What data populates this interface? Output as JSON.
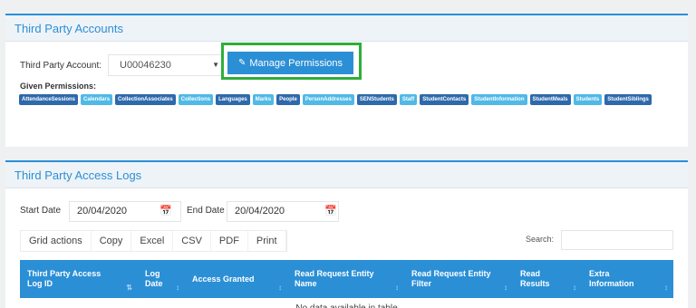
{
  "accounts_panel": {
    "title": "Third Party Accounts",
    "account_label": "Third Party Account:",
    "account_value": "U00046230",
    "manage_button": "Manage Permissions",
    "given_label": "Given Permissions:",
    "permissions": [
      {
        "label": "AttendanceSessions",
        "style": "dark"
      },
      {
        "label": "Calendars",
        "style": "light"
      },
      {
        "label": "CollectionAssociates",
        "style": "dark"
      },
      {
        "label": "Collections",
        "style": "light"
      },
      {
        "label": "Languages",
        "style": "dark"
      },
      {
        "label": "Marks",
        "style": "light"
      },
      {
        "label": "People",
        "style": "dark"
      },
      {
        "label": "PersonAddresses",
        "style": "light"
      },
      {
        "label": "SENStudents",
        "style": "dark"
      },
      {
        "label": "Staff",
        "style": "light"
      },
      {
        "label": "StudentContacts",
        "style": "dark"
      },
      {
        "label": "StudentInformation",
        "style": "light"
      },
      {
        "label": "StudentMeals",
        "style": "dark"
      },
      {
        "label": "Students",
        "style": "light"
      },
      {
        "label": "StudentSiblings",
        "style": "dark"
      }
    ]
  },
  "logs_panel": {
    "title": "Third Party Access Logs",
    "start_label": "Start Date",
    "start_value": "20/04/2020",
    "end_label": "End Date",
    "end_value": "20/04/2020",
    "grid_buttons": [
      "Grid actions",
      "Copy",
      "Excel",
      "CSV",
      "PDF",
      "Print"
    ],
    "search_label": "Search:",
    "columns": [
      {
        "label": "Third Party Access Log ID",
        "width": 130
      },
      {
        "label": "Log Date",
        "width": 52
      },
      {
        "label": "Access Granted",
        "width": 113
      },
      {
        "label": "Read Request Entity Name",
        "width": 129
      },
      {
        "label": "Read Request Entity Filter",
        "width": 120
      },
      {
        "label": "Read Results",
        "width": 76
      },
      {
        "label": "Extra Information",
        "width": 101
      }
    ],
    "empty_text": "No data available in table"
  },
  "colors": {
    "accent": "#2b8fd6",
    "tag_dark": "#2e69ab",
    "tag_light": "#50b9e5",
    "highlight": "#2fae3a"
  }
}
